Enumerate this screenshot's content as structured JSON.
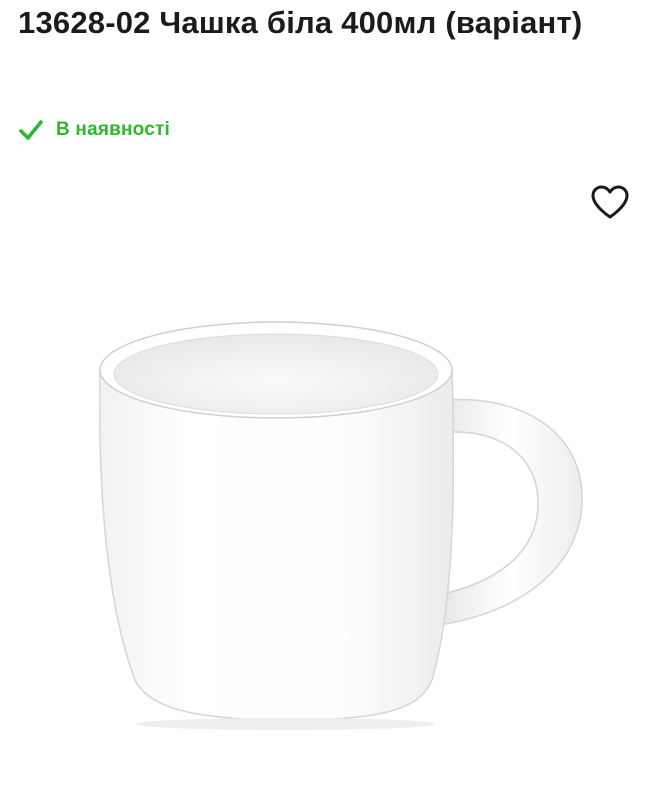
{
  "product": {
    "title": "13628-02 Чашка біла 400мл (варіант)",
    "stock_status": "В наявності",
    "stock_color": "#2eb82e"
  },
  "icons": {
    "stock": "check-icon",
    "wishlist": "heart-outline-icon"
  },
  "image": {
    "subject": "white-mug"
  }
}
